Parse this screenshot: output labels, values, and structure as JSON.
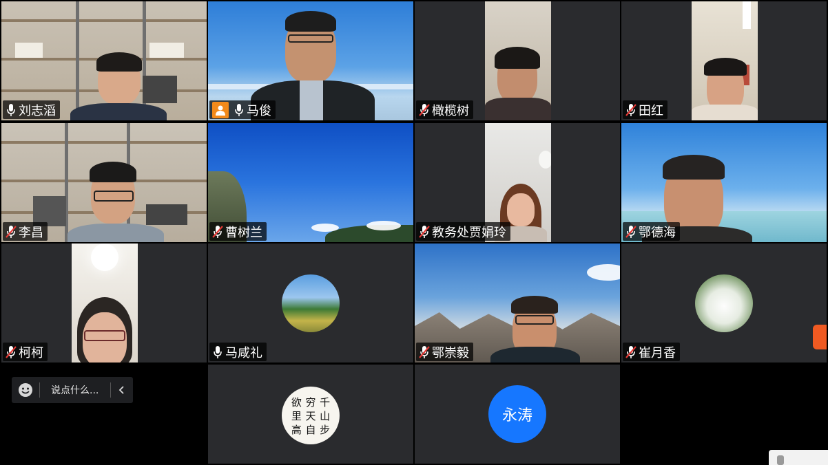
{
  "participants": [
    {
      "name": "刘志滔",
      "muted": false,
      "host": false
    },
    {
      "name": "马俊",
      "muted": false,
      "host": true
    },
    {
      "name": "橄榄树",
      "muted": true,
      "host": false
    },
    {
      "name": "田红",
      "muted": true,
      "host": false
    },
    {
      "name": "李昌",
      "muted": true,
      "host": false
    },
    {
      "name": "曹树兰",
      "muted": true,
      "host": false
    },
    {
      "name": "教务处贾娟玲",
      "muted": true,
      "host": false
    },
    {
      "name": "鄂德海",
      "muted": true,
      "host": false
    },
    {
      "name": "柯柯",
      "muted": true,
      "host": false
    },
    {
      "name": "马咸礼",
      "muted": false,
      "host": false
    },
    {
      "name": "鄂崇毅",
      "muted": true,
      "host": false
    },
    {
      "name": "崔月香",
      "muted": true,
      "host": false
    }
  ],
  "extra_tiles": {
    "avatar_initials": "永涛"
  },
  "calligraphy_chars": [
    "欲",
    "穷",
    "千",
    "里",
    "天",
    "山",
    "高",
    "自",
    "步"
  ],
  "chat": {
    "placeholder": "说点什么...",
    "collapse_icon": "chevron-left-icon",
    "emoji_icon": "emoji-icon"
  },
  "colors": {
    "active_border": "#2fb35a",
    "host_badge": "#f28a1b",
    "avatar_blue": "#1677ff",
    "tile_bg": "#2a2b2e"
  }
}
